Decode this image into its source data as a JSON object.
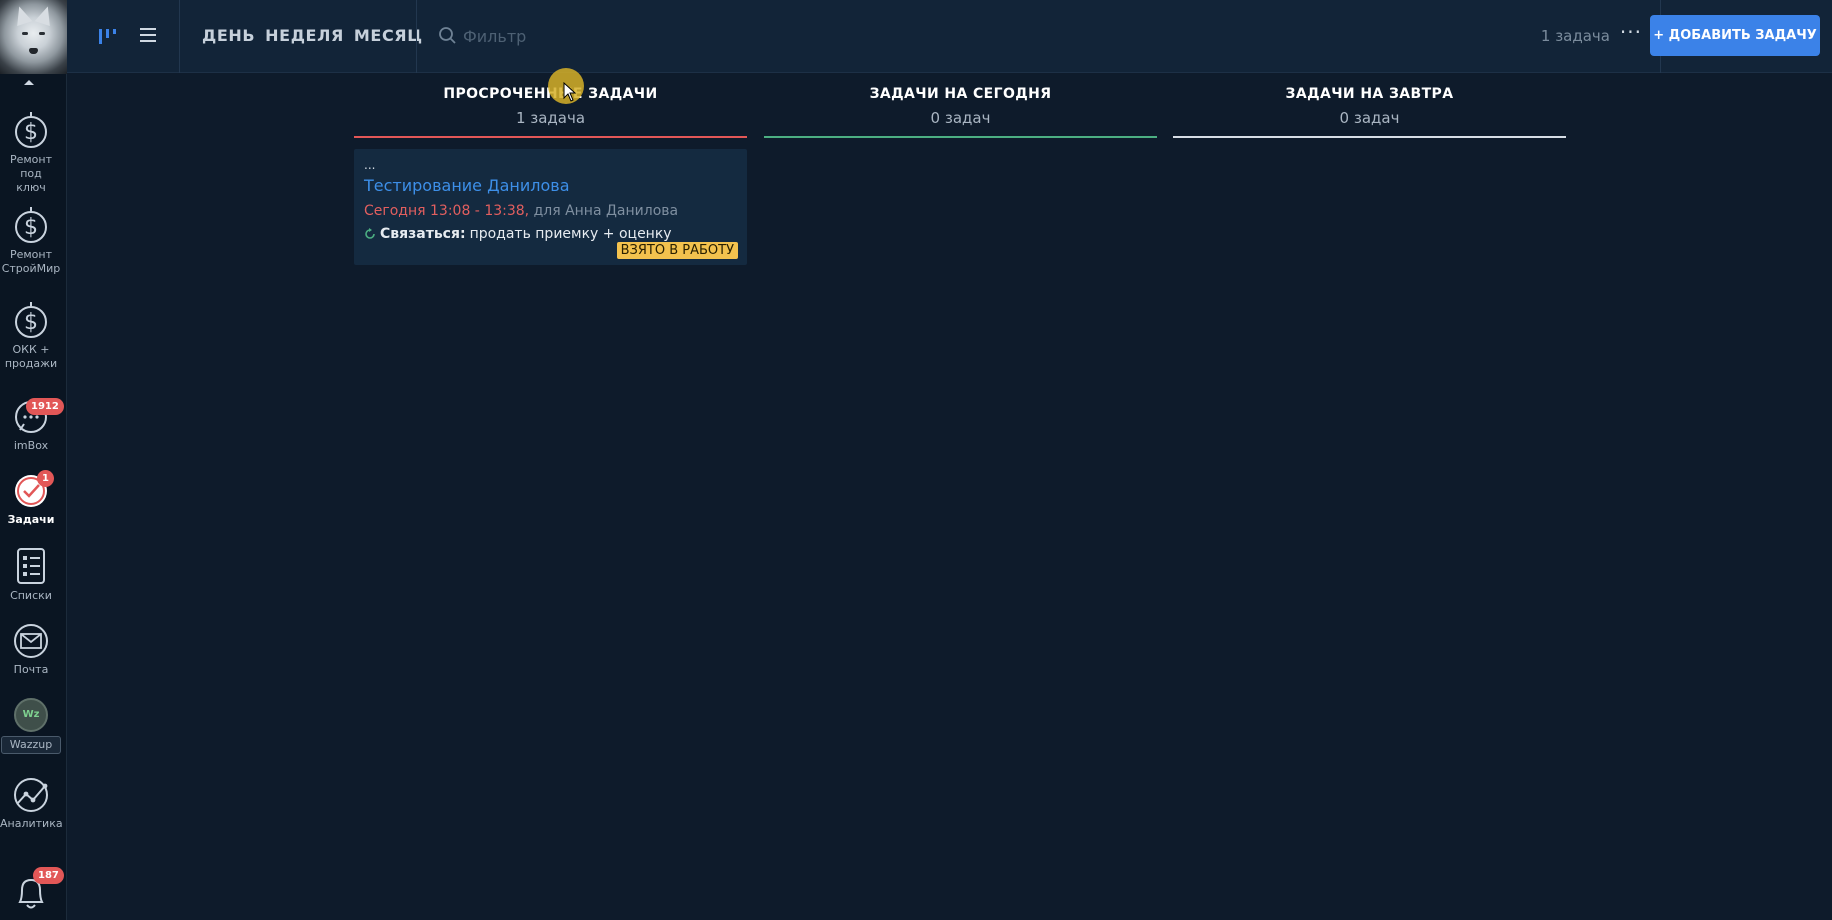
{
  "sidebar": {
    "items": [
      {
        "label_lines": [
          "Ремонт под",
          "ключ"
        ],
        "icon": "dollar-icon"
      },
      {
        "label_lines": [
          "Ремонт",
          "СтройМир"
        ],
        "icon": "dollar-icon"
      },
      {
        "label_lines": [
          "ОКК +",
          "продажи"
        ],
        "icon": "dollar-icon"
      },
      {
        "label": "imBox",
        "icon": "chat-icon",
        "badge": "1912"
      },
      {
        "label": "Задачи",
        "icon": "check-icon",
        "badge": "1",
        "active": true
      },
      {
        "label": "Списки",
        "icon": "list-icon"
      },
      {
        "label": "Почта",
        "icon": "mail-icon"
      },
      {
        "label": "Wazzup",
        "icon": "wazzup-icon",
        "icon_text": "Wz"
      },
      {
        "label": "Аналитика",
        "icon": "analytics-icon"
      },
      {
        "label": "",
        "icon": "bell-icon",
        "badge": "187"
      }
    ]
  },
  "topbar": {
    "tabs": [
      "ДЕНЬ",
      "НЕДЕЛЯ",
      "МЕСЯЦ"
    ],
    "search_placeholder": "Фильтр",
    "task_count": "1 задача",
    "more_label": "···",
    "add_button": "+ ДОБАВИТЬ ЗАДАЧУ"
  },
  "columns": [
    {
      "title": "ПРОСРОЧЕННЫЕ ЗАДАЧИ",
      "count": "1 задача",
      "color": "#e25757"
    },
    {
      "title": "ЗАДАЧИ НА СЕГОДНЯ",
      "count": "0 задач",
      "color": "#4caf82"
    },
    {
      "title": "ЗАДАЧИ НА ЗАВТРА",
      "count": "0 задач",
      "color": "#d6dde5"
    }
  ],
  "task": {
    "dots": "...",
    "title": "Тестирование Данилова",
    "time": "Сегодня 13:08 - 13:38,",
    "assignee": "для Анна Данилова",
    "action_type": "Связаться:",
    "action_text": "продать приемку + оценку",
    "status": "ВЗЯТО В РАБОТУ"
  },
  "colors": {
    "accent": "#3b82e8",
    "overdue": "#e25757",
    "today": "#4caf82",
    "badge": "#e25757",
    "status": "#f3c24e"
  }
}
